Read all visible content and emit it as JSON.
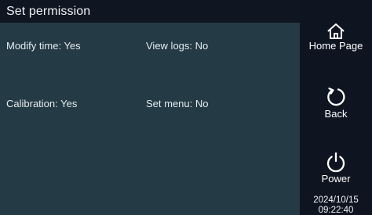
{
  "header": {
    "title": "Set permission"
  },
  "permissions": {
    "modify_time": "Modify time: Yes",
    "view_logs": "View logs: No",
    "calibration": "Calibration: Yes",
    "set_menu": "Set menu: No"
  },
  "nav": {
    "home_label": "Home Page",
    "home_icon": "home-icon",
    "back_label": "Back",
    "back_icon": "refresh-arrow-icon",
    "power_label": "Power",
    "power_icon": "power-icon"
  },
  "status": {
    "date": "2024/10/15",
    "time": "09:22:40"
  },
  "colors": {
    "background": "#0c1520",
    "content_panel": "#243a44",
    "text": "#ffffff"
  }
}
